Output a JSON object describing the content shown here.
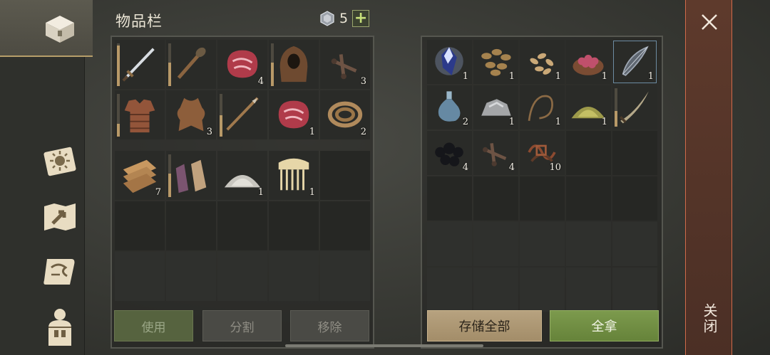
{
  "inventory": {
    "title": "物品栏",
    "gem_count": "5",
    "add_label": "+",
    "top_slots": [
      {
        "name": "sword",
        "qty": "",
        "durability": 0.95
      },
      {
        "name": "torch",
        "qty": "",
        "durability": 0.55
      },
      {
        "name": "raw-meat",
        "qty": "4",
        "durability": null
      },
      {
        "name": "hood",
        "qty": "",
        "durability": 0.55
      },
      {
        "name": "nails",
        "qty": "3",
        "durability": null
      },
      {
        "name": "leather-armor",
        "qty": "",
        "durability": 0.3
      },
      {
        "name": "animal-hide",
        "qty": "3",
        "durability": null
      },
      {
        "name": "wooden-spear",
        "qty": "",
        "durability": 0.5
      },
      {
        "name": "raw-meat",
        "qty": "1",
        "durability": null
      },
      {
        "name": "rope",
        "qty": "2",
        "durability": null
      }
    ],
    "bottom_slots": [
      {
        "name": "fabric",
        "qty": "7",
        "durability": null
      },
      {
        "name": "gloves",
        "qty": "",
        "durability": 0.55
      },
      {
        "name": "salt-pile",
        "qty": "1",
        "durability": null
      },
      {
        "name": "bone-comb",
        "qty": "1",
        "durability": null
      }
    ]
  },
  "storage": {
    "slots": [
      {
        "name": "blue-crystal",
        "qty": "1"
      },
      {
        "name": "seeds",
        "qty": "1"
      },
      {
        "name": "wheat-grains",
        "qty": "1"
      },
      {
        "name": "berries-bowl",
        "qty": "1"
      },
      {
        "name": "bone-bow",
        "qty": "1"
      },
      {
        "name": "glass-flask",
        "qty": "2"
      },
      {
        "name": "stones",
        "qty": "1"
      },
      {
        "name": "leather-cord",
        "qty": "1"
      },
      {
        "name": "sulfur-powder",
        "qty": "1"
      },
      {
        "name": "saber",
        "qty": ""
      },
      {
        "name": "coal",
        "qty": "4"
      },
      {
        "name": "nails",
        "qty": "4"
      },
      {
        "name": "scrap-wires",
        "qty": "10"
      }
    ]
  },
  "buttons": {
    "use": "使用",
    "split": "分割",
    "remove": "移除",
    "store_all": "存储全部",
    "take_all": "全拿"
  },
  "close": {
    "label": "关闭"
  },
  "colors": {
    "accent_green": "#7c9a4d",
    "accent_tan": "#b7a27f",
    "close_border": "#d06a4a"
  }
}
